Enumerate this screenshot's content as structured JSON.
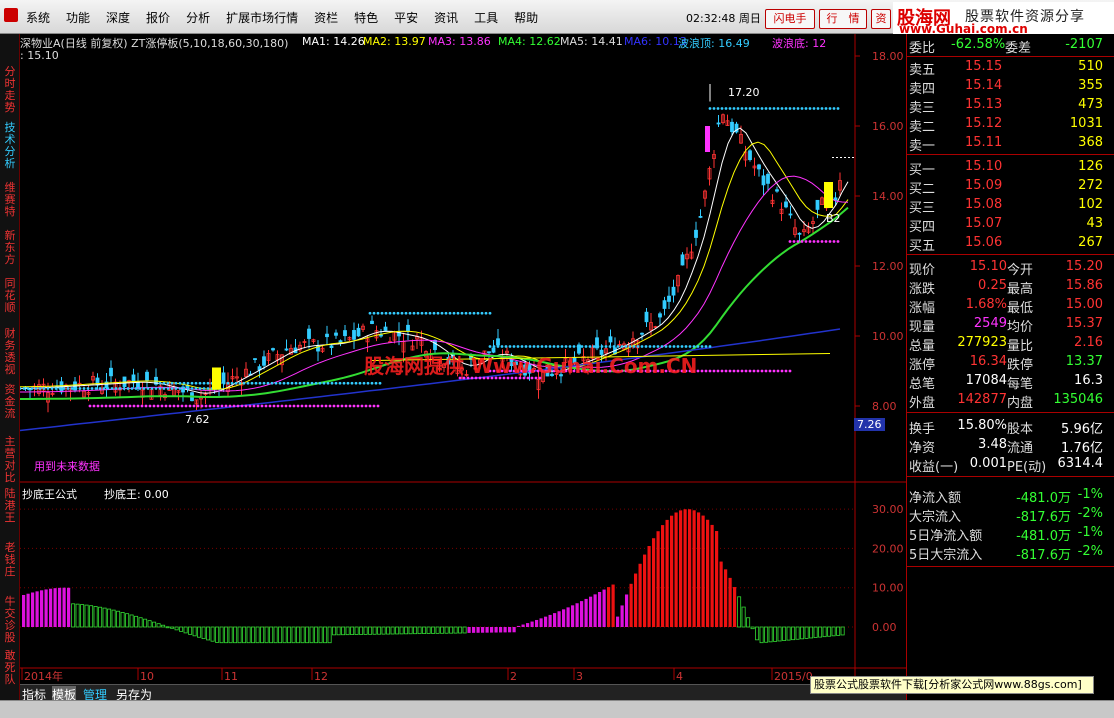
{
  "menu": {
    "items": [
      "系统",
      "功能",
      "深度",
      "报价",
      "分析",
      "扩展市场行情",
      "资栏",
      "特色",
      "平安",
      "资讯",
      "工具",
      "帮助"
    ],
    "clock": "02:32:48 周日",
    "buttons": [
      "闪电手",
      "行　情",
      "资"
    ]
  },
  "brand": {
    "name": "股海网",
    "slogan": "股票软件资源分享",
    "url": "www.Guhai.com.cn"
  },
  "left_tabs": [
    "分时走势",
    "技术分析",
    "维赛特",
    "新东方",
    "同花顺",
    "财务透视",
    "资金流",
    "主营对比",
    "陆港王",
    "老钱庄",
    "牛交诊股",
    "敢死队"
  ],
  "chart_header": {
    "title": "深物业A(日线 前复权) ZT涨停板(5,10,18,60,30,180)",
    "ma1": "MA1: 14.26",
    "ma2": "MA2: 13.97",
    "ma3": "MA3: 13.86",
    "ma4": "MA4: 12.62",
    "ma5": "MA5: 14.41",
    "ma6": "MA6: 10.13",
    "wave_top": "波浪顶: 16.49",
    "wave_bottom": "波浪底: 12",
    "second_line": ": 15.10"
  },
  "annotations": {
    "high_label": "17.20",
    "low_label": "7.62",
    "future_text": "用到未来数据",
    "b_marker": "B2",
    "price_tag": "7.26"
  },
  "sub_header": {
    "name": "抄底王公式",
    "value": "抄底王: 0.00"
  },
  "x_axis": [
    "2014年",
    "10",
    "11",
    "12",
    "2",
    "3",
    "4",
    "2015/0"
  ],
  "y_axis_main": [
    "18.00",
    "16.00",
    "14.00",
    "12.00",
    "10.00",
    "8.00"
  ],
  "y_axis_sub": [
    "30.00",
    "20.00",
    "10.00",
    "0.00"
  ],
  "bottom_tabs": [
    "指标",
    "模板",
    "管理",
    "另存为"
  ],
  "ad_text": "股票公式股票软件下载[分析家公式网www.88gs.com]",
  "watermark": "股海网提供 Www.Guhai.Com.CN",
  "quote": {
    "weibi_label": "委比",
    "weibi": "-62.58%",
    "weicha_label": "委差",
    "weicha": "-2107",
    "asks": [
      {
        "label": "卖五",
        "price": "15.15",
        "vol": "510"
      },
      {
        "label": "卖四",
        "price": "15.14",
        "vol": "355"
      },
      {
        "label": "卖三",
        "price": "15.13",
        "vol": "473"
      },
      {
        "label": "卖二",
        "price": "15.12",
        "vol": "1031"
      },
      {
        "label": "卖一",
        "price": "15.11",
        "vol": "368"
      }
    ],
    "bids": [
      {
        "label": "买一",
        "price": "15.10",
        "vol": "126"
      },
      {
        "label": "买二",
        "price": "15.09",
        "vol": "272"
      },
      {
        "label": "买三",
        "price": "15.08",
        "vol": "102"
      },
      {
        "label": "买四",
        "price": "15.07",
        "vol": "43"
      },
      {
        "label": "买五",
        "price": "15.06",
        "vol": "267"
      }
    ],
    "stats": [
      {
        "l1": "现价",
        "v1": "15.10",
        "l2": "今开",
        "v2": "15.20",
        "c1": "#f33",
        "c2": "#f33"
      },
      {
        "l1": "涨跌",
        "v1": "0.25",
        "l2": "最高",
        "v2": "15.86",
        "c1": "#f33",
        "c2": "#f33"
      },
      {
        "l1": "涨幅",
        "v1": "1.68%",
        "l2": "最低",
        "v2": "15.00",
        "c1": "#f33",
        "c2": "#f33"
      },
      {
        "l1": "现量",
        "v1": "2549",
        "l2": "均价",
        "v2": "15.37",
        "c1": "#f3f",
        "c2": "#f33"
      },
      {
        "l1": "总量",
        "v1": "277923",
        "l2": "量比",
        "v2": "2.16",
        "c1": "#ff0",
        "c2": "#f33"
      },
      {
        "l1": "涨停",
        "v1": "16.34",
        "l2": "跌停",
        "v2": "13.37",
        "c1": "#f33",
        "c2": "#3f3"
      },
      {
        "l1": "总笔",
        "v1": "17084",
        "l2": "每笔",
        "v2": "16.3",
        "c1": "#fff",
        "c2": "#fff"
      },
      {
        "l1": "外盘",
        "v1": "142877",
        "l2": "内盘",
        "v2": "135046",
        "c1": "#f33",
        "c2": "#3f3"
      }
    ],
    "stats2": [
      {
        "l1": "换手",
        "v1": "15.80%",
        "l2": "股本",
        "v2": "5.96亿"
      },
      {
        "l1": "净资",
        "v1": "3.48",
        "l2": "流通",
        "v2": "1.76亿"
      },
      {
        "l1": "收益(一)",
        "v1": "0.001",
        "l2": "PE(动)",
        "v2": "6314.4"
      }
    ],
    "flows": [
      {
        "label": "净流入额",
        "v": "-481.0万",
        "p": "-1%"
      },
      {
        "label": "大宗流入",
        "v": "-817.6万",
        "p": "-2%"
      },
      {
        "label": "5日净流入额",
        "v": "-481.0万",
        "p": "-1%"
      },
      {
        "label": "5日大宗流入",
        "v": "-817.6万",
        "p": "-2%"
      }
    ]
  },
  "colors": {
    "up": "#ff3333",
    "down": "#33ccff",
    "ma_green": "#33dd33",
    "ma_blue": "#2233cc",
    "accent_red": "#cc0000"
  }
}
